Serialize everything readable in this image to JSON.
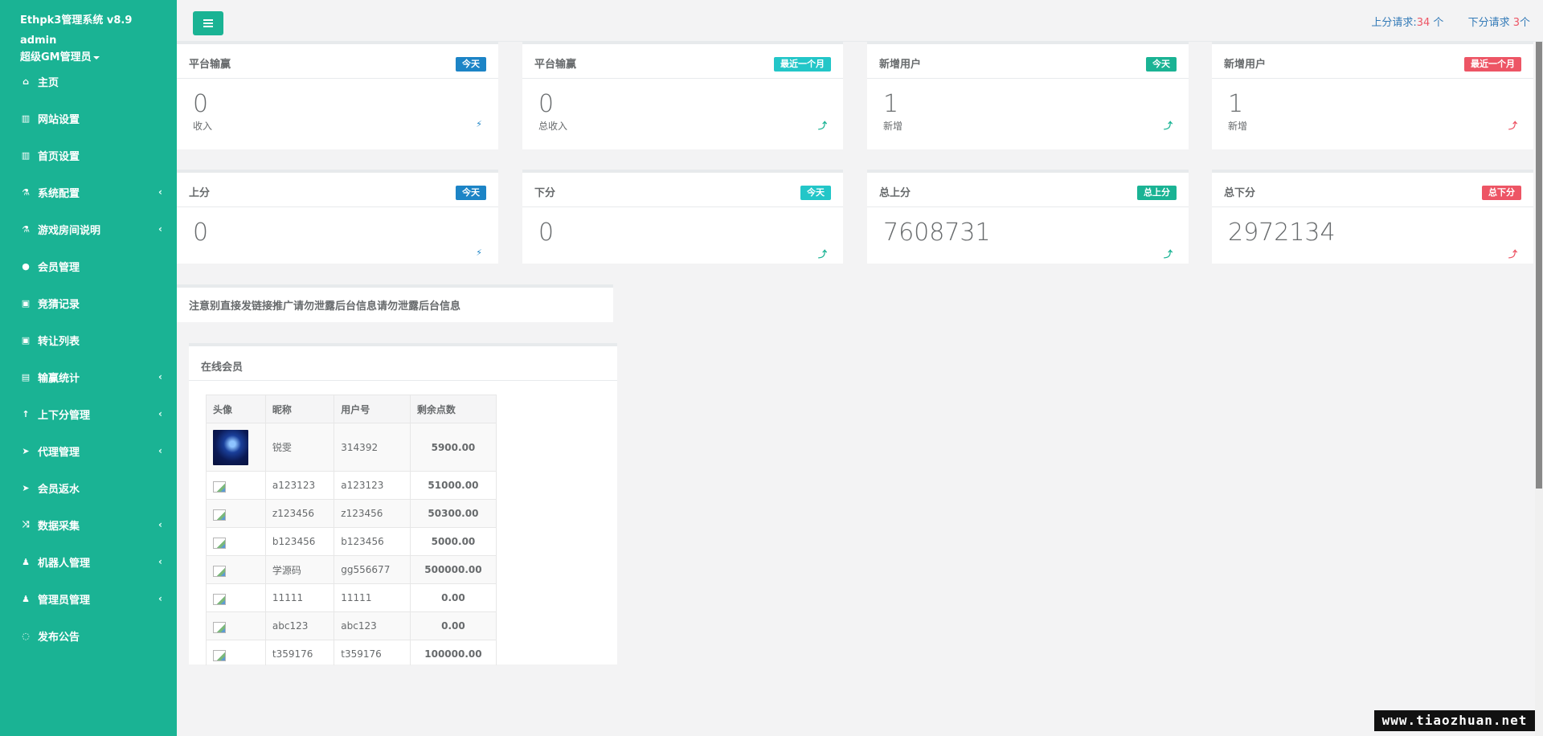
{
  "app": {
    "title": "Ethpk3管理系统 v8.9",
    "user": "admin",
    "role": "超级GM管理员"
  },
  "sidebar": {
    "items": [
      {
        "label": "主页",
        "icon": "home-icon",
        "glyph": "⌂",
        "has_sub": false
      },
      {
        "label": "网站设置",
        "icon": "columns-icon",
        "glyph": "▥",
        "has_sub": false
      },
      {
        "label": "首页设置",
        "icon": "columns-icon",
        "glyph": "▥",
        "has_sub": false
      },
      {
        "label": "系统配置",
        "icon": "flask-icon",
        "glyph": "⚗",
        "has_sub": true
      },
      {
        "label": "游戏房间说明",
        "icon": "flask-icon",
        "glyph": "⚗",
        "has_sub": true
      },
      {
        "label": "会员管理",
        "icon": "user-icon",
        "glyph": "●",
        "has_sub": false
      },
      {
        "label": "竞猜记录",
        "icon": "car-icon",
        "glyph": "▣",
        "has_sub": false
      },
      {
        "label": "转让列表",
        "icon": "car-icon",
        "glyph": "▣",
        "has_sub": false
      },
      {
        "label": "输赢统计",
        "icon": "bar-chart-icon",
        "glyph": "▤",
        "has_sub": true
      },
      {
        "label": "上下分管理",
        "icon": "level-up-icon",
        "glyph": "↑",
        "has_sub": true
      },
      {
        "label": "代理管理",
        "icon": "send-icon",
        "glyph": "➤",
        "has_sub": true
      },
      {
        "label": "会员返水",
        "icon": "send-icon",
        "glyph": "➤",
        "has_sub": false
      },
      {
        "label": "数据采集",
        "icon": "random-icon",
        "glyph": "⤨",
        "has_sub": true
      },
      {
        "label": "机器人管理",
        "icon": "male-icon",
        "glyph": "♟",
        "has_sub": true
      },
      {
        "label": "管理员管理",
        "icon": "male-icon",
        "glyph": "♟",
        "has_sub": true
      },
      {
        "label": "发布公告",
        "icon": "comment-icon",
        "glyph": "◌",
        "has_sub": false
      }
    ]
  },
  "topbar": {
    "up_request_prefix": "上分请求:",
    "up_request_count": "34",
    "up_request_suffix": " 个",
    "down_request_prefix": "下分请求 ",
    "down_request_count": "3",
    "down_request_suffix": "个"
  },
  "stats_row1": [
    {
      "title": "平台输赢",
      "badge": "今天",
      "badge_class": "label-success",
      "value": "0",
      "sub": "收入",
      "arrow": "⚡",
      "arrow_class": "c-blue"
    },
    {
      "title": "平台输赢",
      "badge": "最近一个月",
      "badge_class": "label-info",
      "value": "0",
      "sub": "总收入",
      "arrow": "⤴",
      "arrow_class": "c-navy"
    },
    {
      "title": "新增用户",
      "badge": "今天",
      "badge_class": "label-primary",
      "value": "1",
      "sub": "新增",
      "arrow": "⤴",
      "arrow_class": "c-navy"
    },
    {
      "title": "新增用户",
      "badge": "最近一个月",
      "badge_class": "label-danger",
      "value": "1",
      "sub": "新增",
      "arrow": "⤴",
      "arrow_class": "c-red"
    }
  ],
  "stats_row2": [
    {
      "title": "上分",
      "badge": "今天",
      "badge_class": "label-success",
      "value": "0",
      "arrow": "⚡",
      "arrow_class": "c-blue"
    },
    {
      "title": "下分",
      "badge": "今天",
      "badge_class": "label-info",
      "value": "0",
      "arrow": "⤴",
      "arrow_class": "c-navy"
    },
    {
      "title": "总上分",
      "badge": "总上分",
      "badge_class": "label-primary",
      "value": "7608731",
      "arrow": "⤴",
      "arrow_class": "c-navy"
    },
    {
      "title": "总下分",
      "badge": "总下分",
      "badge_class": "label-danger",
      "value": "2972134",
      "arrow": "⤴",
      "arrow_class": "c-red"
    }
  ],
  "notice": "注意别直接发链接推广请勿泄露后台信息请勿泄露后台信息",
  "online": {
    "title": "在线会员",
    "columns": [
      "头像",
      "昵称",
      "用户号",
      "剩余点数"
    ],
    "rows": [
      {
        "avatar": "photo",
        "nickname": "锐雯",
        "user_id": "314392",
        "points": "5900.00"
      },
      {
        "avatar": "broken",
        "nickname": "a123123",
        "user_id": "a123123",
        "points": "51000.00"
      },
      {
        "avatar": "broken",
        "nickname": "z123456",
        "user_id": "z123456",
        "points": "50300.00"
      },
      {
        "avatar": "broken",
        "nickname": "b123456",
        "user_id": "b123456",
        "points": "5000.00"
      },
      {
        "avatar": "broken",
        "nickname": "学源码",
        "user_id": "gg556677",
        "points": "500000.00"
      },
      {
        "avatar": "broken",
        "nickname": "11111",
        "user_id": "11111",
        "points": "0.00"
      },
      {
        "avatar": "broken",
        "nickname": "abc123",
        "user_id": "abc123",
        "points": "0.00"
      },
      {
        "avatar": "broken",
        "nickname": "t359176",
        "user_id": "t359176",
        "points": "100000.00"
      }
    ]
  },
  "watermark": "www.tiaozhuan.net"
}
